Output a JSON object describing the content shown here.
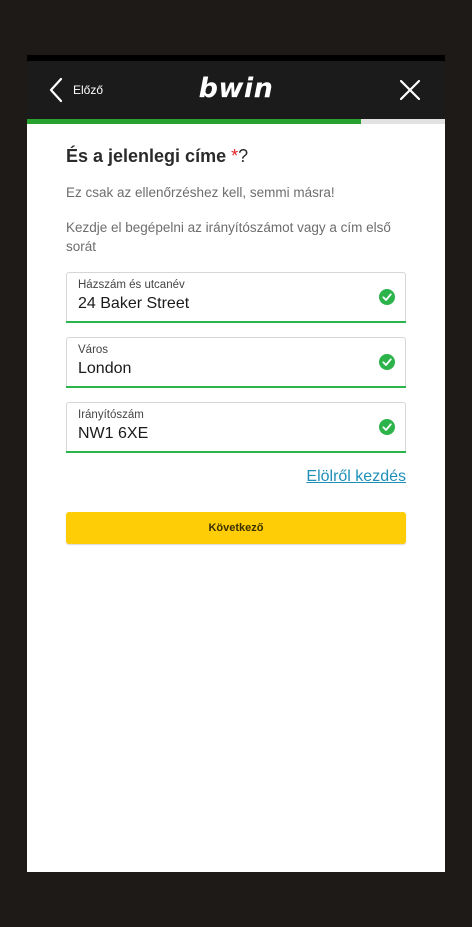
{
  "header": {
    "back_label": "Előző",
    "logo_text": "bwin"
  },
  "progress": {
    "fraction": 0.8
  },
  "form": {
    "heading": "És a jelenlegi címe ",
    "heading_asterisk": "*",
    "heading_qmark": "?",
    "subtext": "Ez csak az ellenőrzéshez kell, semmi másra!",
    "instruction": "Kezdje el begépelni az irányítószámot vagy a cím első sorát",
    "fields": [
      {
        "label": "Házszám és utcanév",
        "value": "24 Baker Street"
      },
      {
        "label": "Város",
        "value": "London"
      },
      {
        "label": "Irányítószám",
        "value": "NW1 6XE"
      }
    ],
    "restart_link": "Elölről kezdés",
    "next_button": "Következő"
  },
  "colors": {
    "header_bg": "#1b1b1b",
    "progress": "#27a22f",
    "valid_green": "#2cb34a",
    "button_yellow": "#fecd05",
    "link_blue": "#1f8fb8",
    "required_red": "#e02020"
  },
  "icons": {
    "back": "chevron-left-icon",
    "close": "close-icon",
    "valid": "check-circle-icon"
  }
}
